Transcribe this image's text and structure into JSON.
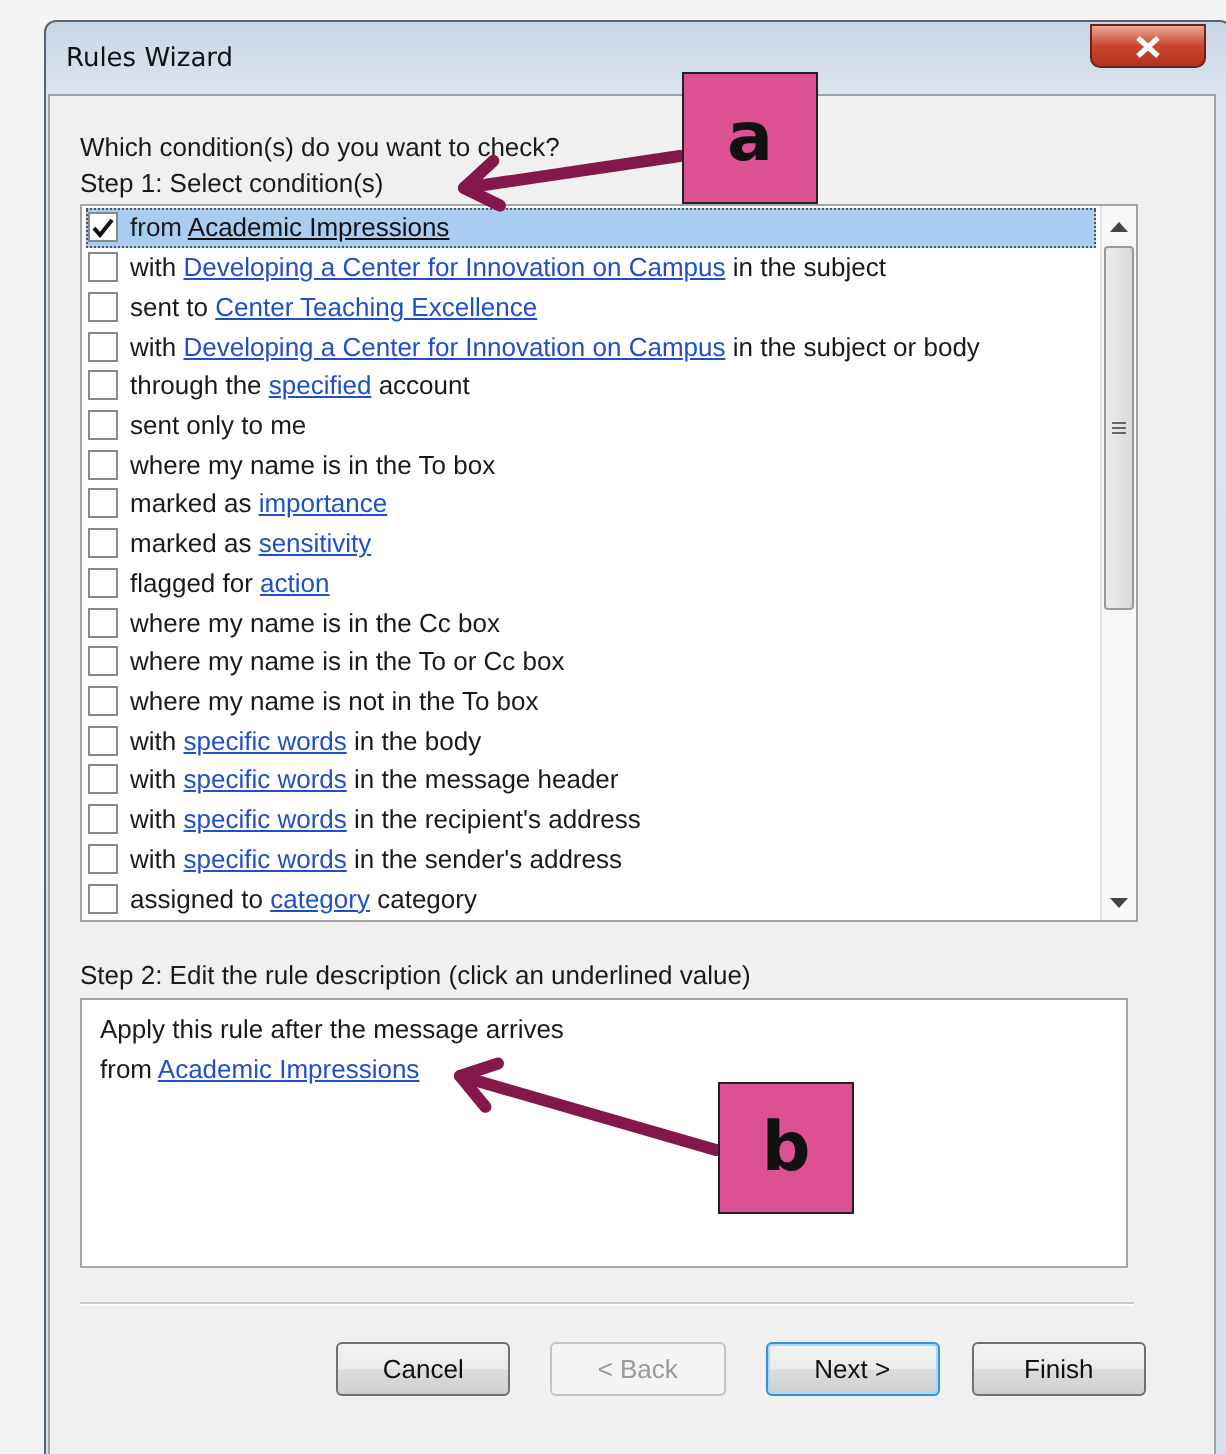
{
  "window": {
    "title": "Rules Wizard"
  },
  "prompt": "Which condition(s) do you want to check?",
  "step1_label": "Step 1: Select condition(s)",
  "conditions": [
    {
      "checked": true,
      "selected": true,
      "parts": [
        {
          "text": "from "
        },
        {
          "text": "Academic Impressions",
          "link": true
        }
      ]
    },
    {
      "checked": false,
      "selected": false,
      "parts": [
        {
          "text": "with "
        },
        {
          "text": "Developing a Center for Innovation on Campus",
          "link": true
        },
        {
          "text": " in the subject"
        }
      ]
    },
    {
      "checked": false,
      "selected": false,
      "parts": [
        {
          "text": "sent to "
        },
        {
          "text": "Center Teaching Excellence",
          "link": true
        }
      ]
    },
    {
      "checked": false,
      "selected": false,
      "parts": [
        {
          "text": "with "
        },
        {
          "text": "Developing a Center for Innovation on Campus",
          "link": true
        },
        {
          "text": " in the subject or body"
        }
      ]
    },
    {
      "checked": false,
      "selected": false,
      "parts": [
        {
          "text": "through the "
        },
        {
          "text": "specified",
          "link": true
        },
        {
          "text": " account"
        }
      ]
    },
    {
      "checked": false,
      "selected": false,
      "parts": [
        {
          "text": "sent only to me"
        }
      ]
    },
    {
      "checked": false,
      "selected": false,
      "parts": [
        {
          "text": "where my name is in the To box"
        }
      ]
    },
    {
      "checked": false,
      "selected": false,
      "parts": [
        {
          "text": "marked as "
        },
        {
          "text": "importance",
          "link": true
        }
      ]
    },
    {
      "checked": false,
      "selected": false,
      "parts": [
        {
          "text": "marked as "
        },
        {
          "text": "sensitivity",
          "link": true
        }
      ]
    },
    {
      "checked": false,
      "selected": false,
      "parts": [
        {
          "text": "flagged for "
        },
        {
          "text": "action",
          "link": true
        }
      ]
    },
    {
      "checked": false,
      "selected": false,
      "parts": [
        {
          "text": "where my name is in the Cc box"
        }
      ]
    },
    {
      "checked": false,
      "selected": false,
      "parts": [
        {
          "text": "where my name is in the To or Cc box"
        }
      ]
    },
    {
      "checked": false,
      "selected": false,
      "parts": [
        {
          "text": "where my name is not in the To box"
        }
      ]
    },
    {
      "checked": false,
      "selected": false,
      "parts": [
        {
          "text": "with "
        },
        {
          "text": "specific words",
          "link": true
        },
        {
          "text": " in the body"
        }
      ]
    },
    {
      "checked": false,
      "selected": false,
      "parts": [
        {
          "text": "with "
        },
        {
          "text": "specific words",
          "link": true
        },
        {
          "text": " in the message header"
        }
      ]
    },
    {
      "checked": false,
      "selected": false,
      "parts": [
        {
          "text": "with "
        },
        {
          "text": "specific words",
          "link": true
        },
        {
          "text": " in the recipient's address"
        }
      ]
    },
    {
      "checked": false,
      "selected": false,
      "parts": [
        {
          "text": "with "
        },
        {
          "text": "specific words",
          "link": true
        },
        {
          "text": " in the sender's address"
        }
      ]
    },
    {
      "checked": false,
      "selected": false,
      "parts": [
        {
          "text": "assigned to "
        },
        {
          "text": "category",
          "link": true
        },
        {
          "text": " category"
        }
      ]
    }
  ],
  "step2_label": "Step 2: Edit the rule description (click an underlined value)",
  "description": [
    [
      {
        "text": "Apply this rule after the message arrives"
      }
    ],
    [
      {
        "text": "from "
      },
      {
        "text": "Academic Impressions",
        "link": true
      }
    ]
  ],
  "buttons": [
    {
      "label": "Cancel",
      "disabled": false,
      "default": false
    },
    {
      "label": "< Back",
      "disabled": true,
      "default": false
    },
    {
      "label": "Next >",
      "disabled": false,
      "default": true
    },
    {
      "label": "Finish",
      "disabled": false,
      "default": false
    }
  ],
  "callouts": [
    {
      "label": "a"
    },
    {
      "label": "b"
    }
  ]
}
